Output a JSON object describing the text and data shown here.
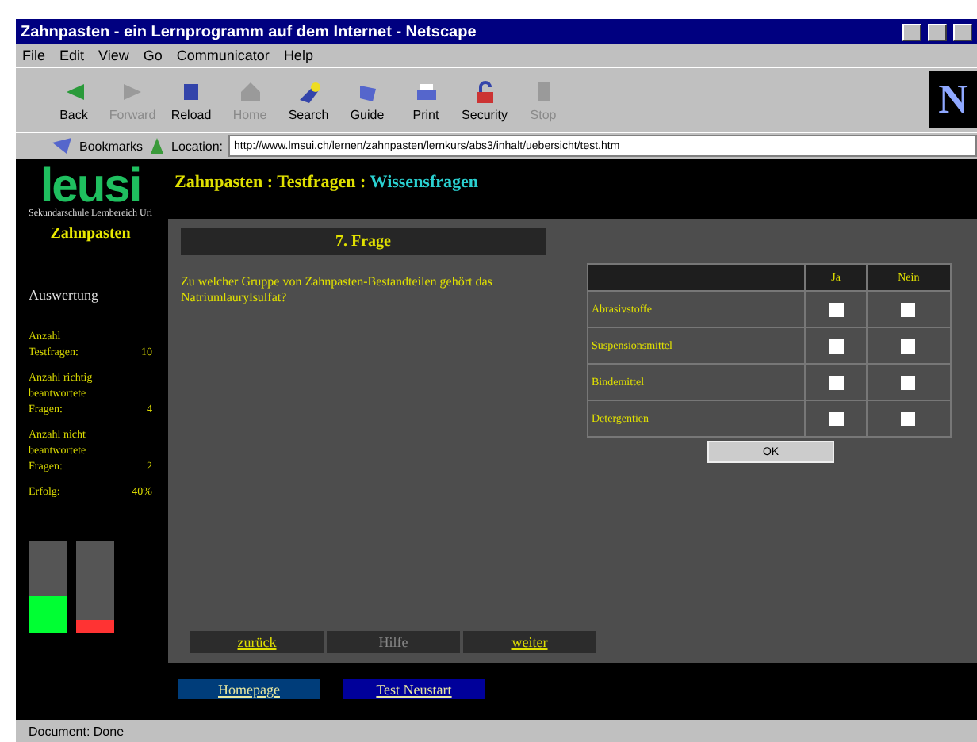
{
  "window": {
    "title": "Zahnpasten - ein Lernprogramm auf dem Internet - Netscape"
  },
  "menu": [
    "File",
    "Edit",
    "View",
    "Go",
    "Communicator",
    "Help"
  ],
  "toolbar": [
    {
      "label": "Back",
      "kind": "back",
      "disabled": false
    },
    {
      "label": "Forward",
      "kind": "forward",
      "disabled": true
    },
    {
      "label": "Reload",
      "kind": "reload",
      "disabled": false
    },
    {
      "label": "Home",
      "kind": "home",
      "disabled": true
    },
    {
      "label": "Search",
      "kind": "search",
      "disabled": false
    },
    {
      "label": "Guide",
      "kind": "guide",
      "disabled": false
    },
    {
      "label": "Print",
      "kind": "print",
      "disabled": false
    },
    {
      "label": "Security",
      "kind": "security",
      "disabled": false
    },
    {
      "label": "Stop",
      "kind": "stop",
      "disabled": true
    }
  ],
  "browser_logo": "N",
  "location_bar": {
    "bookmarks": "Bookmarks",
    "label": "Location:",
    "url": "http://www.lmsui.ch/lernen/zahnpasten/lernkurs/abs3/inhalt/uebersicht/test.htm"
  },
  "sidebar": {
    "logo": "leusi",
    "subtitle": "Sekundarschule Lernbereich Uri",
    "topic": "Zahnpasten",
    "section": "Auswertung",
    "stats": [
      {
        "label": "Anzahl Testfragen:",
        "value": "10"
      },
      {
        "label": "Anzahl richtig beantwortete Fragen:",
        "value": "4"
      },
      {
        "label": "Anzahl nicht beantwortete Fragen:",
        "value": "2"
      },
      {
        "label": "Erfolg:",
        "value": "40%"
      }
    ],
    "bars": [
      {
        "level": 0.4,
        "color": "#00ff33"
      },
      {
        "level": 0.13,
        "color": "#ff3333"
      }
    ]
  },
  "breadcrumb": {
    "path": "Zahnpasten : Testfragen : ",
    "current": "Wissensfragen"
  },
  "question": {
    "title": "7. Frage",
    "text": "Zu welcher Gruppe von Zahnpasten-Bestandteilen gehört das Natriumlaurylsulfat?"
  },
  "answers": {
    "columns": [
      "Ja",
      "Nein"
    ],
    "rows": [
      {
        "label": "Abrasivstoffe",
        "ja": false,
        "nein": false
      },
      {
        "label": "Suspensionsmittel",
        "ja": false,
        "nein": false
      },
      {
        "label": "Bindemittel",
        "ja": false,
        "nein": false
      },
      {
        "label": "Detergentien",
        "ja": false,
        "nein": false
      }
    ],
    "submit": "OK"
  },
  "nav": [
    {
      "label": "zurück",
      "disabled": false
    },
    {
      "label": "Hilfe",
      "disabled": true
    },
    {
      "label": "weiter",
      "disabled": false
    }
  ],
  "footer_links": [
    {
      "label": "Homepage",
      "color": "#003d7a"
    },
    {
      "label": "Test Neustart",
      "color": "#00009a"
    }
  ],
  "status_bar": {
    "text": "Document: Done"
  }
}
